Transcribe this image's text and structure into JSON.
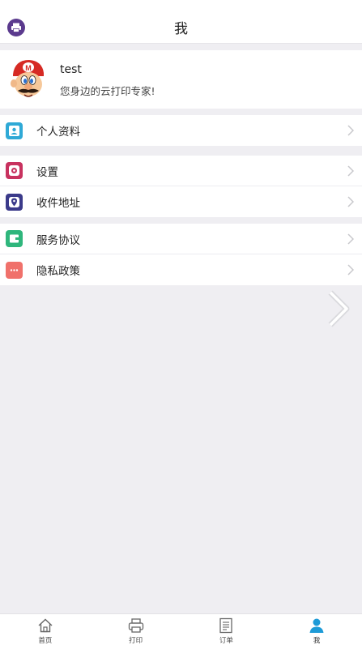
{
  "header": {
    "title": "我"
  },
  "profile": {
    "name": "test",
    "subtitle": "您身边的云打印专家!"
  },
  "menu": {
    "groups": [
      {
        "items": [
          {
            "label": "个人资料",
            "icon": "profile-icon",
            "color": "#2fa9d6"
          }
        ]
      },
      {
        "items": [
          {
            "label": "设置",
            "icon": "settings-icon",
            "color": "#c8325f"
          },
          {
            "label": "收件地址",
            "icon": "location-icon",
            "color": "#3b3a8a"
          }
        ]
      },
      {
        "items": [
          {
            "label": "服务协议",
            "icon": "agreement-icon",
            "color": "#2fb67c"
          },
          {
            "label": "隐私政策",
            "icon": "privacy-icon",
            "color": "#f0716b"
          }
        ]
      }
    ]
  },
  "tabbar": {
    "tabs": [
      {
        "label": "首页",
        "icon": "home-icon"
      },
      {
        "label": "打印",
        "icon": "printer-icon"
      },
      {
        "label": "订单",
        "icon": "orders-icon"
      },
      {
        "label": "我",
        "icon": "user-icon",
        "active": true
      }
    ]
  },
  "colors": {
    "accent": "#5b3a8e",
    "active_tab": "#1e9bd7",
    "background": "#efeef2"
  }
}
